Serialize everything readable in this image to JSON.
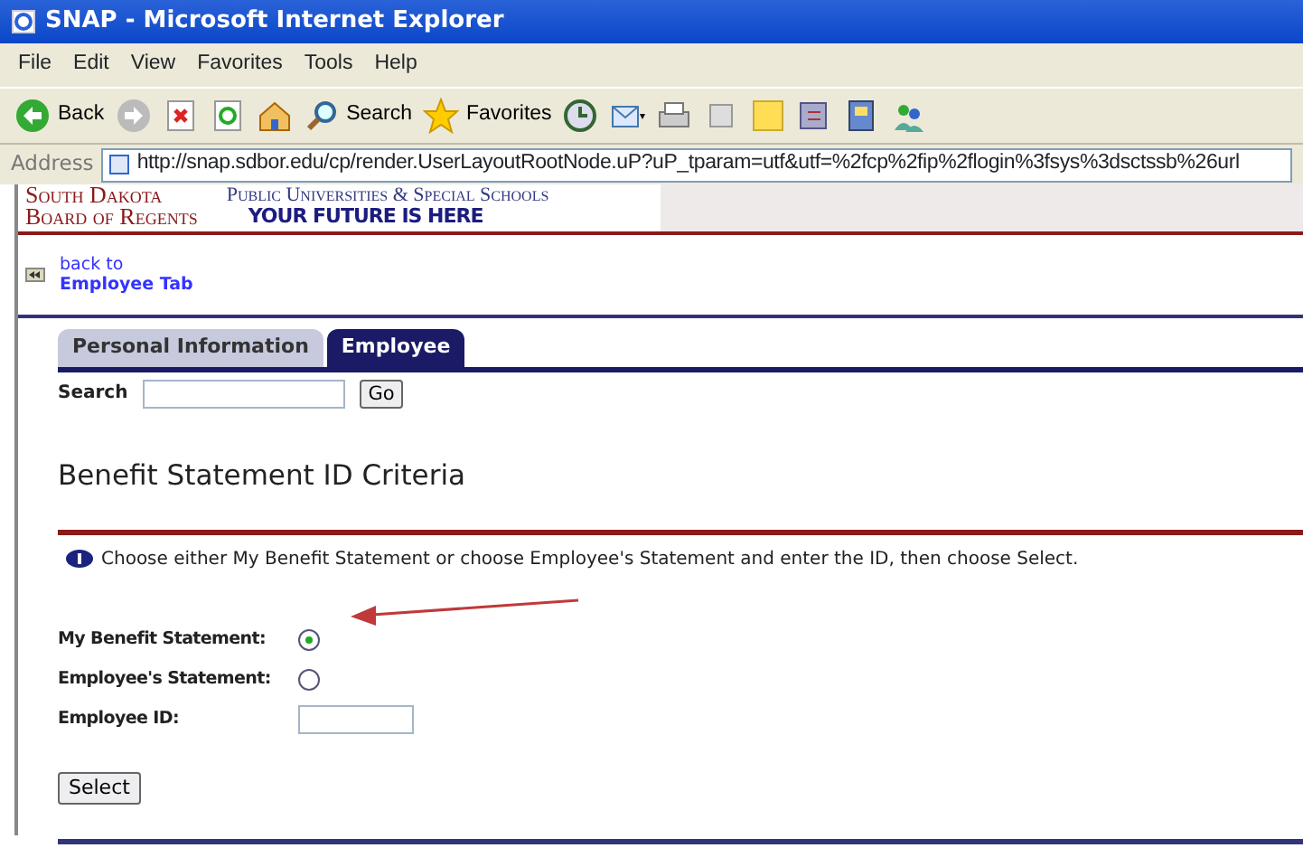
{
  "window": {
    "title": "SNAP - Microsoft Internet Explorer"
  },
  "menu": [
    "File",
    "Edit",
    "View",
    "Favorites",
    "Tools",
    "Help"
  ],
  "toolbar": [
    {
      "kind": "back",
      "label": "Back"
    },
    {
      "kind": "forward"
    },
    {
      "kind": "stop"
    },
    {
      "kind": "refresh"
    },
    {
      "kind": "home"
    },
    {
      "kind": "search",
      "label": "Search"
    },
    {
      "kind": "favorites",
      "label": "Favorites"
    },
    {
      "kind": "history"
    },
    {
      "kind": "mail"
    },
    {
      "kind": "print"
    },
    {
      "kind": "edit"
    },
    {
      "kind": "note"
    },
    {
      "kind": "messenger"
    },
    {
      "kind": "research"
    },
    {
      "kind": "people"
    }
  ],
  "address": {
    "label": "Address",
    "url": "http://snap.sdbor.edu/cp/render.UserLayoutRootNode.uP?uP_tparam=utf&utf=%2fcp%2fip%2flogin%3fsys%3dsctssb%26url"
  },
  "banner": {
    "org_line_1": "South Dakota",
    "org_line_2": "Board of Regents",
    "subtitle": "Public Universities & Special Schools",
    "slogan": "YOUR FUTURE IS HERE"
  },
  "back_link": {
    "line_1": "back to",
    "line_2": "Employee Tab"
  },
  "tabs": [
    {
      "label": "Personal Information",
      "selected": false
    },
    {
      "label": "Employee",
      "selected": true
    }
  ],
  "search": {
    "label": "Search",
    "button": "Go"
  },
  "heading": "Benefit Statement ID Criteria",
  "info": "Choose either My Benefit Statement or choose Employee's Statement and enter the ID, then choose Select.",
  "fields": [
    {
      "kind": "radio",
      "label": "My Benefit Statement:",
      "selected": true
    },
    {
      "kind": "radio",
      "label": "Employee's Statement:",
      "selected": false
    },
    {
      "kind": "text",
      "label": "Employee ID:"
    }
  ],
  "submit": "Select"
}
